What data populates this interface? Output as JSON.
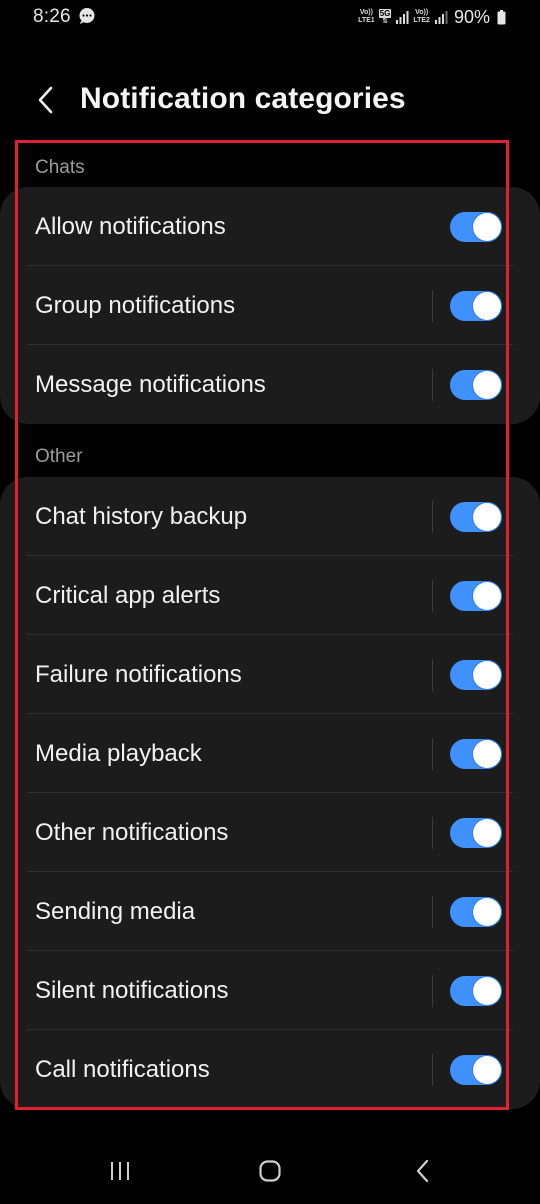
{
  "status_bar": {
    "time": "8:26",
    "sim1_top": "Vo))",
    "sim1_bottom": "LTE1",
    "badge_5g": "5G",
    "sim2_top": "Vo))",
    "sim2_bottom": "LTE2",
    "battery": "90%"
  },
  "header": {
    "title": "Notification categories"
  },
  "sections": [
    {
      "title": "Chats",
      "items": [
        {
          "label": "Allow notifications",
          "enabled": true
        },
        {
          "label": "Group notifications",
          "enabled": true
        },
        {
          "label": "Message notifications",
          "enabled": true
        }
      ]
    },
    {
      "title": "Other",
      "items": [
        {
          "label": "Chat history backup",
          "enabled": true
        },
        {
          "label": "Critical app alerts",
          "enabled": true
        },
        {
          "label": "Failure notifications",
          "enabled": true
        },
        {
          "label": "Media playback",
          "enabled": true
        },
        {
          "label": "Other notifications",
          "enabled": true
        },
        {
          "label": "Sending media",
          "enabled": true
        },
        {
          "label": "Silent notifications",
          "enabled": true
        },
        {
          "label": "Call notifications",
          "enabled": true
        }
      ]
    }
  ],
  "colors": {
    "background": "#010101",
    "card": "#1c1c1c",
    "toggle_on": "#3e91ff",
    "highlight": "#e02033"
  },
  "icons": {
    "back": "chevron-left-icon",
    "recents": "recents-icon",
    "home": "home-icon",
    "nav_back": "nav-back-icon"
  }
}
